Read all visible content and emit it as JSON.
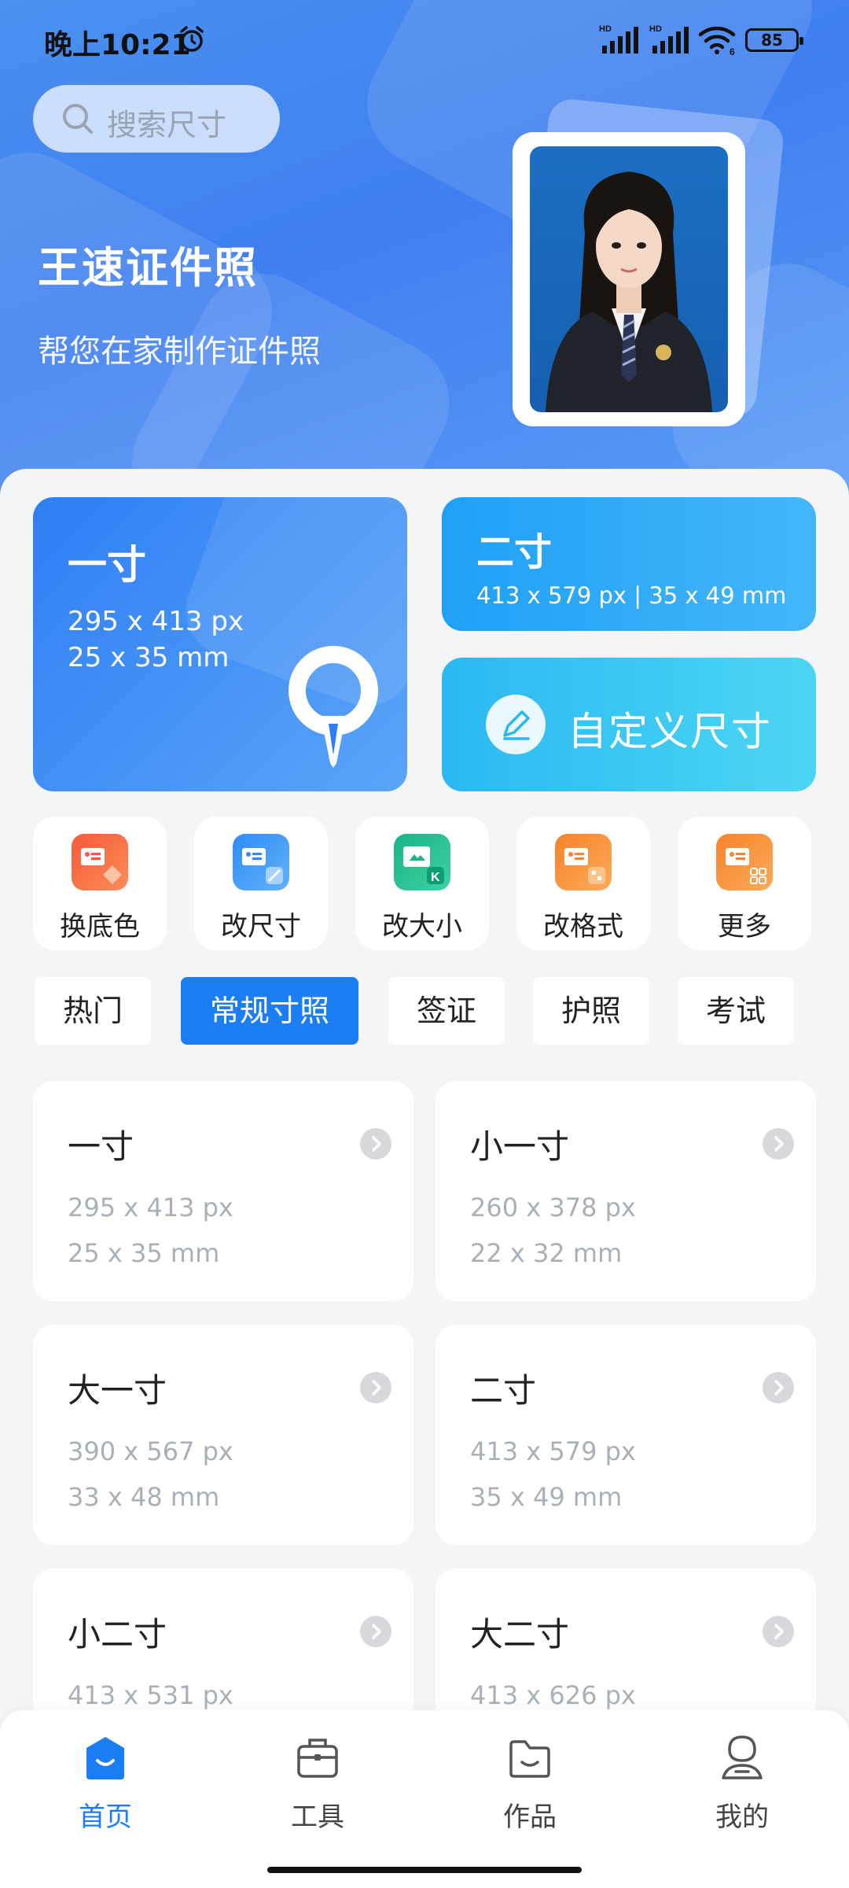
{
  "status_bar": {
    "time": "晚上10:21",
    "signal1_label": "HD",
    "signal2_label": "HD",
    "wifi_label": "6",
    "battery": "85"
  },
  "search": {
    "placeholder": "搜索尺寸"
  },
  "header": {
    "title": "王速证件照",
    "subtitle": "帮您在家制作证件照"
  },
  "featured": {
    "one_inch": {
      "title": "一寸",
      "px": "295 x 413 px",
      "mm": "25 x 35 mm"
    },
    "two_inch": {
      "title": "二寸",
      "desc": "413 x 579 px | 35 x 49 mm"
    },
    "custom": {
      "title": "自定义尺寸"
    }
  },
  "tools": [
    {
      "label": "换底色",
      "icon": "change-background-icon",
      "color": "#f76a3a"
    },
    {
      "label": "改尺寸",
      "icon": "resize-icon",
      "color": "#2f8cf6"
    },
    {
      "label": "改大小",
      "icon": "file-size-icon",
      "color": "#1fb890"
    },
    {
      "label": "改格式",
      "icon": "format-icon",
      "color": "#f7832a"
    },
    {
      "label": "更多",
      "icon": "more-icon",
      "color": "#f7832a"
    }
  ],
  "tabs": [
    {
      "label": "热门",
      "active": false
    },
    {
      "label": "常规寸照",
      "active": true
    },
    {
      "label": "签证",
      "active": false
    },
    {
      "label": "护照",
      "active": false
    },
    {
      "label": "考试",
      "active": false
    }
  ],
  "sizes": [
    {
      "name": "一寸",
      "px": "295 x 413 px",
      "mm": "25 x 35 mm"
    },
    {
      "name": "小一寸",
      "px": "260 x 378 px",
      "mm": "22 x 32 mm"
    },
    {
      "name": "大一寸",
      "px": "390 x 567 px",
      "mm": "33 x 48 mm"
    },
    {
      "name": "二寸",
      "px": "413 x 579 px",
      "mm": "35 x 49 mm"
    },
    {
      "name": "小二寸",
      "px": "413 x 531 px",
      "mm": ""
    },
    {
      "name": "大二寸",
      "px": "413 x 626 px",
      "mm": ""
    }
  ],
  "bottom_nav": [
    {
      "label": "首页",
      "icon": "home-icon",
      "active": true
    },
    {
      "label": "工具",
      "icon": "toolbox-icon",
      "active": false
    },
    {
      "label": "作品",
      "icon": "folder-icon",
      "active": false
    },
    {
      "label": "我的",
      "icon": "profile-icon",
      "active": false
    }
  ],
  "colors": {
    "accent": "#1c7ef4",
    "hero": "#3f7ff0"
  }
}
